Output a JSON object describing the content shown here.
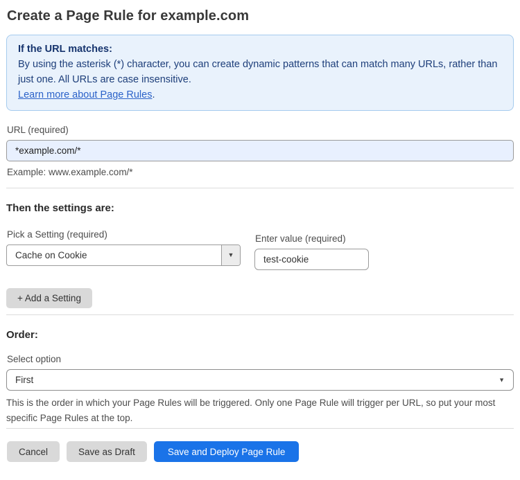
{
  "page": {
    "title": "Create a Page Rule for example.com"
  },
  "info_box": {
    "heading": "If the URL matches:",
    "body": "By using the asterisk (*) character, you can create dynamic patterns that can match many URLs, rather than just one. All URLs are case insensitive.",
    "link_label": "Learn more about Page Rules",
    "link_suffix": "."
  },
  "url_section": {
    "label": "URL (required)",
    "value": "*example.com/*",
    "example": "Example: www.example.com/*"
  },
  "settings_section": {
    "heading": "Then the settings are:",
    "setting_label": "Pick a Setting (required)",
    "setting_value": "Cache on Cookie",
    "value_label": "Enter value (required)",
    "value_value": "test-cookie",
    "add_button_label": "+ Add a Setting"
  },
  "order_section": {
    "heading": "Order:",
    "select_label": "Select option",
    "select_value": "First",
    "help_text": "This is the order in which your Page Rules will be triggered. Only one Page Rule will trigger per URL, so put your most specific Page Rules at the top."
  },
  "footer": {
    "cancel_label": "Cancel",
    "save_draft_label": "Save as Draft",
    "save_deploy_label": "Save and Deploy Page Rule"
  },
  "colors": {
    "info_bg": "#e9f2fc",
    "info_border": "#a5cbee",
    "info_text": "#1d3e7a",
    "link_blue": "#2b62c9",
    "autofill_input_bg": "#e8f0fe",
    "primary_blue": "#1a73e8",
    "button_gray": "#d9d9d9"
  },
  "icons": {
    "dropdown_arrow": "▼"
  }
}
